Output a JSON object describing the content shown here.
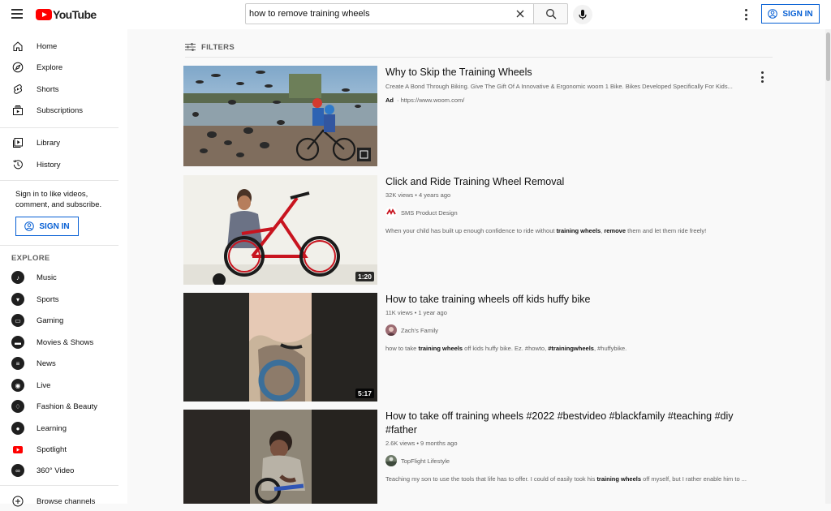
{
  "header": {
    "logo_text": "YouTube",
    "search_value": "how to remove training wheels",
    "signin_label": "SIGN IN"
  },
  "sidebar": {
    "items": [
      {
        "label": "Home",
        "icon": "home-icon"
      },
      {
        "label": "Explore",
        "icon": "compass-icon"
      },
      {
        "label": "Shorts",
        "icon": "shorts-icon"
      },
      {
        "label": "Subscriptions",
        "icon": "subscriptions-icon"
      },
      {
        "label": "Library",
        "icon": "library-icon"
      },
      {
        "label": "History",
        "icon": "history-icon"
      }
    ],
    "sign_in_text": "Sign in to like videos, comment, and subscribe.",
    "signin_label": "SIGN IN",
    "explore_heading": "EXPLORE",
    "explore_items": [
      {
        "label": "Music",
        "icon": "music-icon"
      },
      {
        "label": "Sports",
        "icon": "trophy-icon"
      },
      {
        "label": "Gaming",
        "icon": "gaming-icon"
      },
      {
        "label": "Movies & Shows",
        "icon": "movies-icon"
      },
      {
        "label": "News",
        "icon": "news-icon"
      },
      {
        "label": "Live",
        "icon": "live-icon"
      },
      {
        "label": "Fashion & Beauty",
        "icon": "hanger-icon"
      },
      {
        "label": "Learning",
        "icon": "bulb-icon"
      },
      {
        "label": "Spotlight",
        "icon": "spotlight-icon"
      },
      {
        "label": "360° Video",
        "icon": "vr-icon"
      },
      {
        "label": "Browse channels",
        "icon": "plus-icon"
      }
    ]
  },
  "filters_label": "FILTERS",
  "results": [
    {
      "title": "Why to Skip the Training Wheels",
      "description": "Create A Bond Through Biking. Give The Gift Of A Innovative & Ergonomic woom 1 Bike. Bikes Developed Specifically For Kids...",
      "ad_label": "Ad",
      "ad_url": "· https://www.woom.com/"
    },
    {
      "title": "Click and Ride Training Wheel Removal",
      "meta": "32K views • 4 years ago",
      "channel": "SMS Product Design",
      "duration": "1:20",
      "desc_parts": [
        "When your child has built up enough confidence to ride without ",
        "training wheels",
        ", ",
        "remove",
        " them and let them ride freely!"
      ]
    },
    {
      "title": "How to take training wheels off kids huffy bike",
      "meta": "11K views • 1 year ago",
      "channel": "Zach's Family",
      "duration": "5:17",
      "desc_parts": [
        "how to take ",
        "training wheels",
        " off kids huffy bike. Ez. #howto, ",
        "#trainingwheels",
        ", #huffybike."
      ]
    },
    {
      "title": "How to take off training wheels #2022 #bestvideo #blackfamily #teaching #diy #father",
      "meta": "2.6K views • 9 months ago",
      "channel": "TopFlight Lifestyle",
      "desc_parts": [
        "Teaching my son to use the tools that life has to offer. I could of easily took his ",
        "training wheels",
        " off myself, but I rather enable him to ..."
      ]
    }
  ]
}
